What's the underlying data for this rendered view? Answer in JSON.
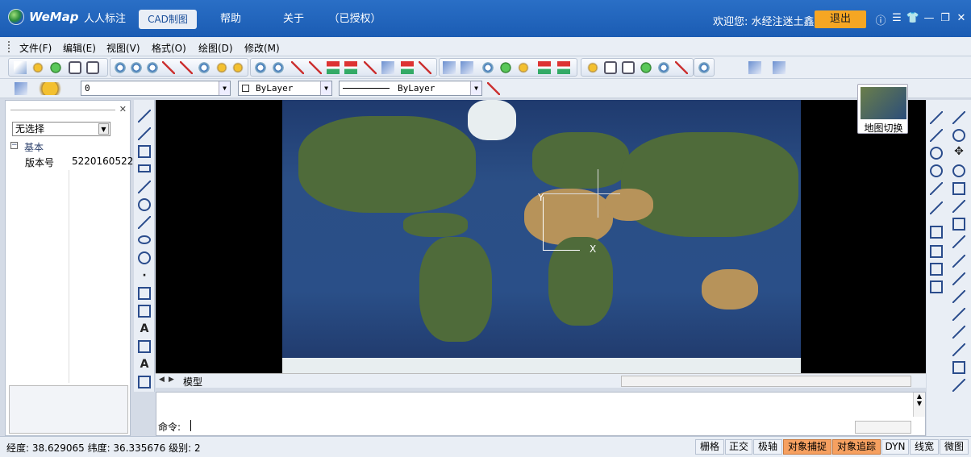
{
  "app": {
    "logo_text": "WeMap"
  },
  "tabs": [
    {
      "label": "人人标注"
    },
    {
      "label": "CAD制图"
    },
    {
      "label": "帮助"
    },
    {
      "label": "关于"
    },
    {
      "label": "（已授权）"
    }
  ],
  "header": {
    "welcome": "欢迎您: 水经注迷土鑫",
    "logout": "退出",
    "icons": [
      "info-icon",
      "menu-icon",
      "shirt-icon",
      "minimize-icon",
      "restore-icon",
      "close-icon"
    ]
  },
  "menu": [
    {
      "label": "文件(F)"
    },
    {
      "label": "编辑(E)"
    },
    {
      "label": "视图(V)"
    },
    {
      "label": "格式(O)"
    },
    {
      "label": "绘图(D)"
    },
    {
      "label": "修改(M)"
    }
  ],
  "layer": {
    "value": "0"
  },
  "color": {
    "value": "ByLayer"
  },
  "linetype": {
    "value": "ByLayer"
  },
  "left_panel": {
    "select_value": "无选择",
    "group": "基本",
    "prop_key": "版本号",
    "prop_value": "5220160522"
  },
  "map_switch": {
    "label": "地图切换"
  },
  "model_tab": {
    "label": "模型"
  },
  "command": {
    "prompt": "命令:"
  },
  "status": {
    "coords": "经度: 38.629065 纬度: 36.335676 级别: 2",
    "buttons": [
      {
        "label": "栅格",
        "on": false
      },
      {
        "label": "正交",
        "on": false
      },
      {
        "label": "极轴",
        "on": false
      },
      {
        "label": "对象捕捉",
        "on": true
      },
      {
        "label": "对象追踪",
        "on": true
      },
      {
        "label": "DYN",
        "on": false
      },
      {
        "label": "线宽",
        "on": false
      },
      {
        "label": "微图",
        "on": false
      }
    ]
  },
  "colors": {
    "titlebar": "#1b5cb3",
    "logout": "#f6a623",
    "status_on": "#f6a060"
  }
}
